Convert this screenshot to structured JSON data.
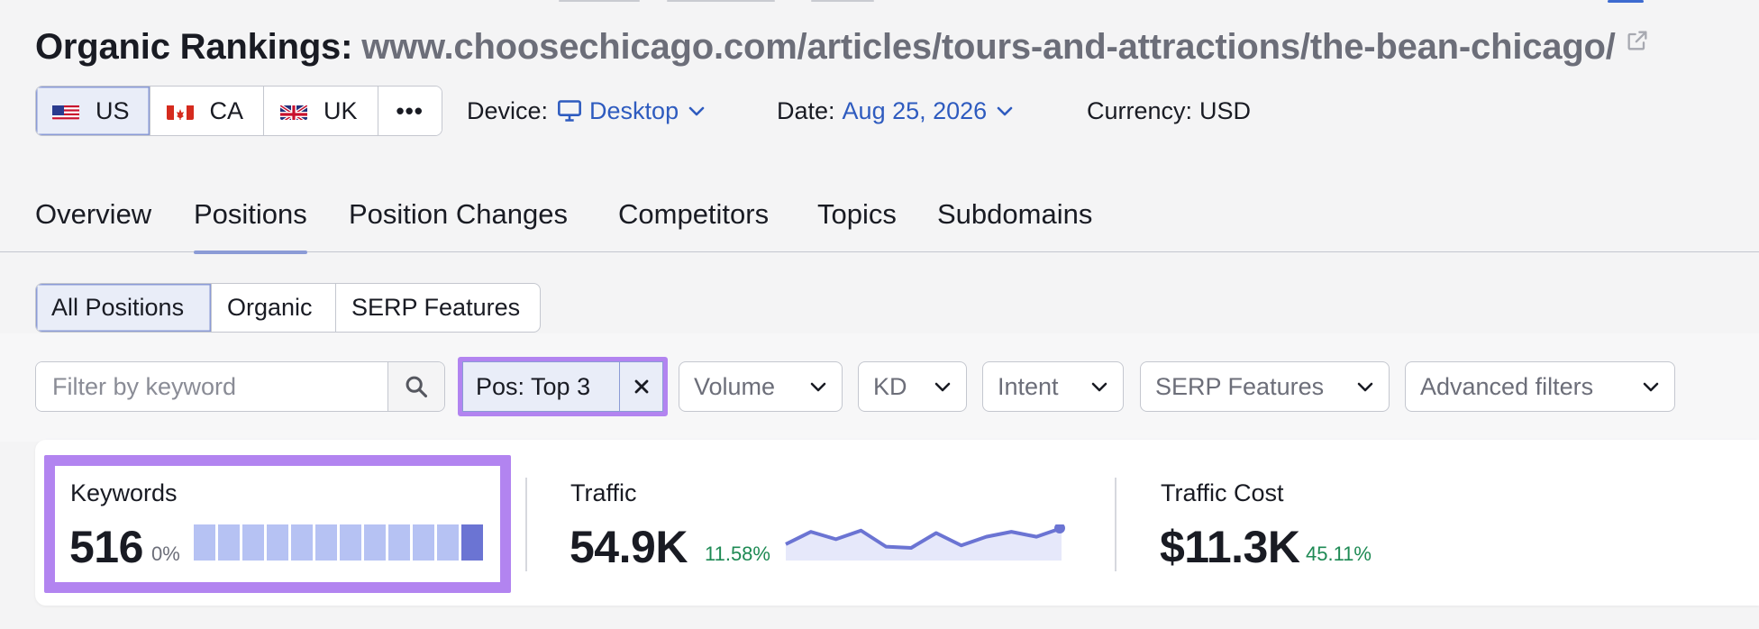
{
  "header": {
    "title": "Organic Rankings:",
    "domain": "www.choosechicago.com/articles/tours-and-attractions/the-bean-chicago/"
  },
  "databases": [
    {
      "code": "US",
      "flag": "us-flag-icon",
      "active": true
    },
    {
      "code": "CA",
      "flag": "ca-flag-icon",
      "active": false
    },
    {
      "code": "UK",
      "flag": "uk-flag-icon",
      "active": false
    }
  ],
  "more_label": "•••",
  "device": {
    "label": "Device:",
    "value": "Desktop",
    "icon": "monitor-icon"
  },
  "date": {
    "label": "Date:",
    "value": "Aug 25, 2026"
  },
  "currency": {
    "label": "Currency:",
    "value": "USD"
  },
  "tabs": [
    {
      "label": "Overview",
      "active": false
    },
    {
      "label": "Positions",
      "active": true
    },
    {
      "label": "Position Changes",
      "active": false
    },
    {
      "label": "Competitors",
      "active": false
    },
    {
      "label": "Topics",
      "active": false
    },
    {
      "label": "Subdomains",
      "active": false
    }
  ],
  "position_types": [
    {
      "label": "All Positions",
      "active": true
    },
    {
      "label": "Organic",
      "active": false
    },
    {
      "label": "SERP Features",
      "active": false
    }
  ],
  "filters": {
    "search_placeholder": "Filter by keyword",
    "active_chip": "Pos: Top 3",
    "dropdowns": [
      "Volume",
      "KD",
      "Intent",
      "SERP Features",
      "Advanced filters"
    ]
  },
  "summary": {
    "keywords": {
      "label": "Keywords",
      "value": "516",
      "change": "0%",
      "trend": [
        1,
        1,
        1,
        1,
        1,
        1,
        1,
        1,
        1,
        1,
        1,
        1
      ],
      "highlight_last": true
    },
    "traffic": {
      "label": "Traffic",
      "value": "54.9K",
      "change": "11.58%",
      "trend": [
        54.0,
        55.0,
        54.4,
        55.1,
        53.8,
        53.7,
        54.9,
        53.9,
        54.6,
        55.0,
        54.6,
        55.3
      ]
    },
    "traffic_cost": {
      "label": "Traffic Cost",
      "value": "$11.3K",
      "change": "45.11%"
    }
  },
  "colors": {
    "accent_purple": "#b284f0",
    "link_blue": "#2e5bbf",
    "positive_green": "#1e8a54",
    "bar_light": "#b6c2f3",
    "bar_dark": "#6b74d3"
  }
}
